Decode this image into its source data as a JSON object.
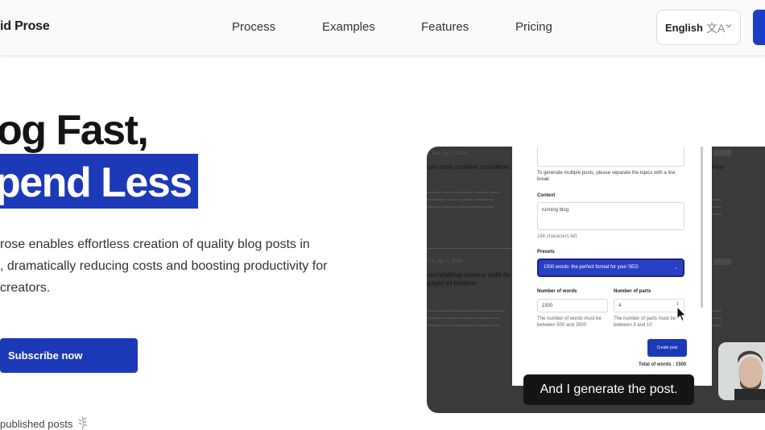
{
  "header": {
    "logo": "id Prose",
    "nav": [
      "Process",
      "Examples",
      "Features",
      "Pricing"
    ],
    "language": "English",
    "language_icon": "translate-icon",
    "chevron_icon": "chevron-down-icon"
  },
  "hero": {
    "line1": "og Fast,",
    "line2": "pend Less",
    "description": [
      "rose enables effortless creation of quality blog posts in",
      ", dramatically reducing costs and boosting productivity for",
      " creators."
    ],
    "subscribe_label": "Subscribe now",
    "published_label": "published posts",
    "published_icon": "laurel-icon"
  },
  "video": {
    "caption": "And I generate the post.",
    "bg_left": {
      "post1_date": "Tue, Apr 2, 2024",
      "post1_title": "urir mon premier marathon",
      "post2_date": "Tue, Apr 2, 2024",
      "post2_title_1": "storytelling comme outil de le",
      "post2_title_2": "gager et inspirer"
    },
    "bg_right": {
      "fun": "Fun"
    },
    "form": {
      "topics_hint_1": "To generate multiple posts, please separate the topics with a line",
      "topics_hint_2": "break",
      "context_label": "Context",
      "context_value": "running blog",
      "chars_left": "188 characters left",
      "presets_label": "Presets",
      "preset_selected": "1500 words: the perfect format for your SEO",
      "words_label": "Number of words",
      "words_value": "1500",
      "words_hint_1": "The number of words must be",
      "words_hint_2": "between 500 and 2500",
      "parts_label": "Number of parts",
      "parts_value": "4",
      "parts_hint_1": "The number of parts must be",
      "parts_hint_2": "between 3 and 10",
      "create_label": "Create post",
      "total_words": "Total of words : 1500"
    }
  },
  "colors": {
    "accent": "#1c39b8",
    "video_bg": "#3a3a3a",
    "caption_bg": "#151515"
  }
}
